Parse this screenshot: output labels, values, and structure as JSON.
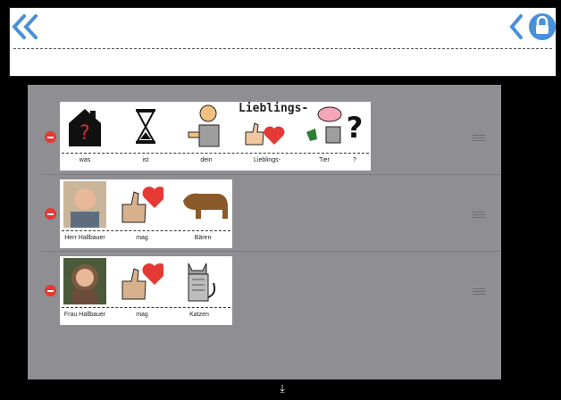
{
  "toolbar": {
    "back_icon": "double-chevron-left-icon",
    "prev_icon": "chevron-left-icon",
    "lock_icon": "lock-icon",
    "accent": "#4a90d9"
  },
  "sentences": [
    {
      "words": [
        {
          "label": "was",
          "icon": "house-question-icon"
        },
        {
          "label": "ist",
          "icon": "hourglass-icon"
        },
        {
          "label": "dein",
          "icon": "person-pointing-icon"
        },
        {
          "label": "Lieblings-",
          "icon": "thumb-heart-icon",
          "caption": "Lieblings-"
        },
        {
          "label": "Tier",
          "icon": "animals-icon"
        },
        {
          "label": "?",
          "icon": "question-mark-icon"
        }
      ]
    },
    {
      "words": [
        {
          "label": "Herr Hallbauer",
          "icon": "photo-man-icon"
        },
        {
          "label": "mag",
          "icon": "thumb-heart-icon"
        },
        {
          "label": "Bären",
          "icon": "bear-icon"
        }
      ]
    },
    {
      "words": [
        {
          "label": "Frau Hallbauer",
          "icon": "photo-woman-icon"
        },
        {
          "label": "mag",
          "icon": "thumb-heart-icon"
        },
        {
          "label": "Katzen",
          "icon": "cat-icon"
        }
      ]
    }
  ],
  "bottom": {
    "icon": "download-arrow-icon",
    "glyph": "⤓"
  }
}
